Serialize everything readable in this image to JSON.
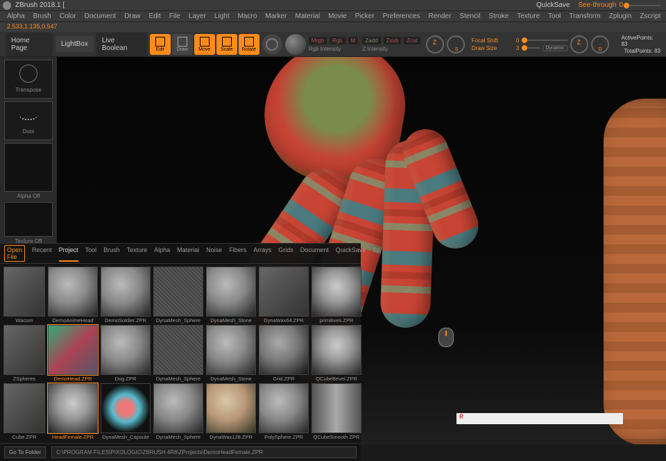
{
  "title": "ZBrush 2018.1 [",
  "quicksave": "QuickSave",
  "see_through": {
    "label": "See-through",
    "value": 0
  },
  "menus": [
    "Alpha",
    "Brush",
    "Color",
    "Document",
    "Draw",
    "Edit",
    "File",
    "Layer",
    "Light",
    "Macro",
    "Marker",
    "Material",
    "Movie",
    "Picker",
    "Preferences",
    "Render",
    "Stencil",
    "Stroke",
    "Texture",
    "Tool",
    "Transform",
    "Zplugin",
    "Zscript"
  ],
  "coords": "2.533,1.135,0.547",
  "toolbar": {
    "homepage": "Home Page",
    "lightbox": "LightBox",
    "live_boolean": "Live Boolean",
    "modes": [
      {
        "label": "Edit",
        "key": "edit-mode"
      },
      {
        "label": "Draw",
        "key": "draw-mode",
        "grey": true
      },
      {
        "label": "Move",
        "key": "move-mode"
      },
      {
        "label": "Scale",
        "key": "scale-mode"
      },
      {
        "label": "Rotate",
        "key": "rotate-mode"
      }
    ],
    "mini": {
      "mrgb": "Mrgb",
      "rgb": "Rgb",
      "m": "M",
      "rgb_intensity": "Rgb Intensity",
      "zadd": "Zadd",
      "zsub": "Zsub",
      "zcut": "Zcut",
      "z_intensity": "Z Intensity"
    },
    "focal_shift": {
      "label": "Focal Shift",
      "value": 0
    },
    "draw_size": {
      "label": "Draw Size",
      "value": 3
    },
    "dynamic": "Dynamic",
    "active_points": {
      "label": "ActivePoints:",
      "value": 83
    },
    "total_points": {
      "label": "TotalPoints:",
      "value": 83
    }
  },
  "left_panel": {
    "transpose": "Transpose",
    "dots": "Dots",
    "alpha_off": "Alpha Off",
    "texture_off": "Texture Off"
  },
  "lightbox": {
    "tabs": [
      "Open File",
      "Recent",
      "Project",
      "Tool",
      "Brush",
      "Texture",
      "Alpha",
      "Material",
      "Noise",
      "Fibers",
      "Arrays",
      "Grids",
      "Document",
      "QuickSave",
      "Sp"
    ],
    "active_tab": "Project",
    "special_tab": "Open File",
    "rows": [
      [
        {
          "label": "Wacom",
          "style": "flat"
        },
        {
          "label": "DemoAnimeHead",
          "style": "sphere"
        },
        {
          "label": "DemoSoldier.ZPR",
          "style": "sphere"
        },
        {
          "label": "DynaMesh_Sphere",
          "style": "noise"
        },
        {
          "label": "DynaMesh_Stone",
          "style": "sphere"
        },
        {
          "label": "DynaWax64.ZPR",
          "style": "flat"
        },
        {
          "label": "primitives.ZPR",
          "style": "face"
        }
      ],
      [
        {
          "label": "ZSpheres",
          "style": "flat"
        },
        {
          "label": "DemoHead.ZPR",
          "style": "box",
          "hl": true
        },
        {
          "label": "Dog.ZPR",
          "style": "sphere"
        },
        {
          "label": "DynaMesh_Sphere",
          "style": "noise"
        },
        {
          "label": "DynaMesh_Stone",
          "style": "sphere"
        },
        {
          "label": "Grid.ZPR",
          "style": "grid"
        },
        {
          "label": "QCubeBevel.ZPR",
          "style": "face"
        }
      ],
      [
        {
          "label": "Cube.ZPR",
          "style": "flat"
        },
        {
          "label": "HeadFemale.ZPR",
          "style": "face",
          "hl": true
        },
        {
          "label": "DynaMesh_Capsule",
          "style": "capsule"
        },
        {
          "label": "DynaMesh_Sphere",
          "style": "sphere"
        },
        {
          "label": "DynaWax128.ZPR",
          "style": "tan"
        },
        {
          "label": "PolySphere.ZPR",
          "style": "sphere"
        },
        {
          "label": "QCubeSmooth.ZPR",
          "style": "cylinder"
        }
      ]
    ],
    "go_to_folder": "Go To Folder",
    "path": "C:\\PROGRAM FILES\\PIXOLOGIC\\ZBRUSH 4R8\\ZProjects\\DemoHeadFemale.ZPR"
  },
  "bottom_input": "R"
}
